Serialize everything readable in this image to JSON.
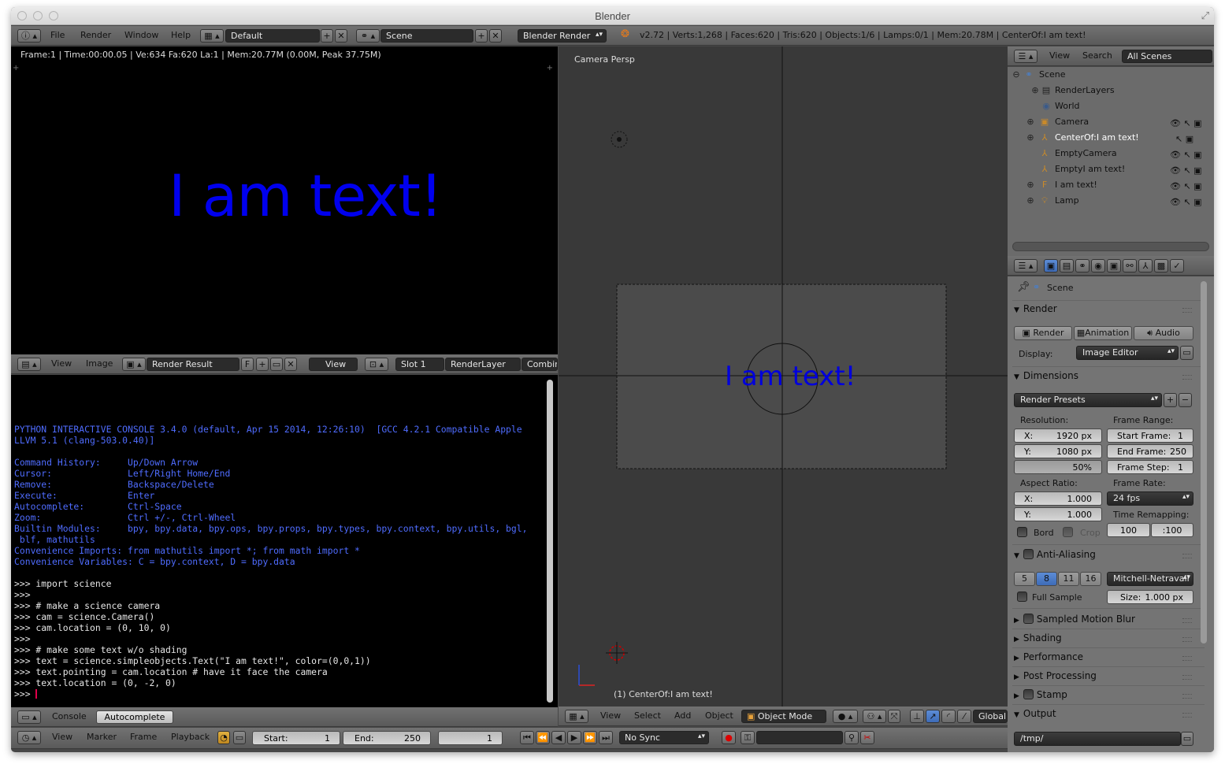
{
  "window": {
    "title": "Blender"
  },
  "info_header": {
    "menus": [
      "File",
      "Render",
      "Window",
      "Help"
    ],
    "layout": "Default",
    "scene": "Scene",
    "engine": "Blender Render",
    "stats": "v2.72 | Verts:1,268 | Faces:620 | Tris:620 | Objects:1/6 | Lamps:0/1 | Mem:20.78M | CenterOf:I am text!"
  },
  "image_editor": {
    "info": "Frame:1 | Time:00:00.05 | Ve:634 Fa:620 La:1 | Mem:20.77M (0.00M, Peak 37.75M)",
    "render_text": "I am text!",
    "header": {
      "view": "View",
      "image": "Image",
      "image_name": "Render Result",
      "f_label": "F",
      "view_mode": "View",
      "slot": "Slot 1",
      "layer": "RenderLayer",
      "pass": "Combin"
    }
  },
  "console": {
    "lines_blue": [
      "PYTHON INTERACTIVE CONSOLE 3.4.0 (default, Apr 15 2014, 12:26:10)  [GCC 4.2.1 Compatible Apple",
      "LLVM 5.1 (clang-503.0.40)]",
      "",
      "Command History:     Up/Down Arrow",
      "Cursor:              Left/Right Home/End",
      "Remove:              Backspace/Delete",
      "Execute:             Enter",
      "Autocomplete:        Ctrl-Space",
      "Zoom:                Ctrl +/-, Ctrl-Wheel",
      "Builtin Modules:     bpy, bpy.data, bpy.ops, bpy.props, bpy.types, bpy.context, bpy.utils, bgl,",
      " blf, mathutils",
      "Convenience Imports: from mathutils import *; from math import *",
      "Convenience Variables: C = bpy.context, D = bpy.data"
    ],
    "lines_white": [
      "",
      ">>> import science",
      ">>> ",
      ">>> # make a science camera",
      ">>> cam = science.Camera()",
      ">>> cam.location = (0, 10, 0)",
      ">>> ",
      ">>> # make some text w/o shading",
      ">>> text = science.simpleobjects.Text(\"I am text!\", color=(0,0,1))",
      ">>> text.pointing = cam.location # have it face the camera",
      ">>> text.location = (0, -2, 0)"
    ],
    "prompt": ">>> ",
    "header": {
      "console": "Console",
      "autocomplete": "Autocomplete"
    }
  },
  "viewport": {
    "title": "Camera Persp",
    "status": "(1) CenterOf:I am text!",
    "scene_text": "I am text!",
    "header": {
      "view": "View",
      "select": "Select",
      "add": "Add",
      "object": "Object",
      "mode": "Object Mode",
      "orientation": "Global"
    }
  },
  "outliner": {
    "header": {
      "view": "View",
      "search": "Search",
      "filter": "All Scenes"
    },
    "items": [
      {
        "label": "Scene",
        "icon": "scene-icon"
      },
      {
        "label": "RenderLayers",
        "icon": "render-layers-icon"
      },
      {
        "label": "World",
        "icon": "world-icon"
      },
      {
        "label": "Camera",
        "icon": "camera-object-icon"
      },
      {
        "label": "CenterOf:I am text!",
        "icon": "empty-icon"
      },
      {
        "label": "EmptyCamera",
        "icon": "empty-icon"
      },
      {
        "label": "EmptyI am text!",
        "icon": "empty-icon"
      },
      {
        "label": "I am text!",
        "icon": "font-icon"
      },
      {
        "label": "Lamp",
        "icon": "lamp-icon"
      }
    ]
  },
  "properties": {
    "context": "Scene",
    "render": {
      "title": "Render",
      "render_btn": "Render",
      "animation_btn": "Animation",
      "audio_btn": "Audio",
      "display_label": "Display:",
      "display_value": "Image Editor"
    },
    "dimensions": {
      "title": "Dimensions",
      "presets": "Render Presets",
      "resolution_label": "Resolution:",
      "res_x_label": "X:",
      "res_x": "1920 px",
      "res_y_label": "Y:",
      "res_y": "1080 px",
      "res_pct": "50%",
      "frame_range_label": "Frame Range:",
      "start_label": "Start Frame:",
      "start": "1",
      "end_label": "End Frame:",
      "end": "250",
      "step_label": "Frame Step:",
      "step": "1",
      "aspect_label": "Aspect Ratio:",
      "aspect_x_label": "X:",
      "aspect_x": "1.000",
      "aspect_y_label": "Y:",
      "aspect_y": "1.000",
      "frame_rate_label": "Frame Rate:",
      "frame_rate": "24 fps",
      "time_remap_label": "Time Remapping:",
      "remap_old": "100",
      "remap_new": ":100",
      "bord": "Bord",
      "crop": "Crop"
    },
    "anti_aliasing": {
      "title": "Anti-Aliasing",
      "samples": [
        "5",
        "8",
        "11",
        "16"
      ],
      "active_sample": "8",
      "filter": "Mitchell-Netravali",
      "full_sample": "Full Sample",
      "size_label": "Size:",
      "size": "1.000 px"
    },
    "collapsed": [
      "Sampled Motion Blur",
      "Shading",
      "Performance",
      "Post Processing",
      "Stamp"
    ],
    "output": {
      "title": "Output",
      "path": "/tmp/"
    }
  },
  "timeline": {
    "view": "View",
    "marker": "Marker",
    "frame": "Frame",
    "playback": "Playback",
    "start_label": "Start:",
    "start": "1",
    "end_label": "End:",
    "end": "250",
    "current": "1",
    "sync": "No Sync"
  }
}
